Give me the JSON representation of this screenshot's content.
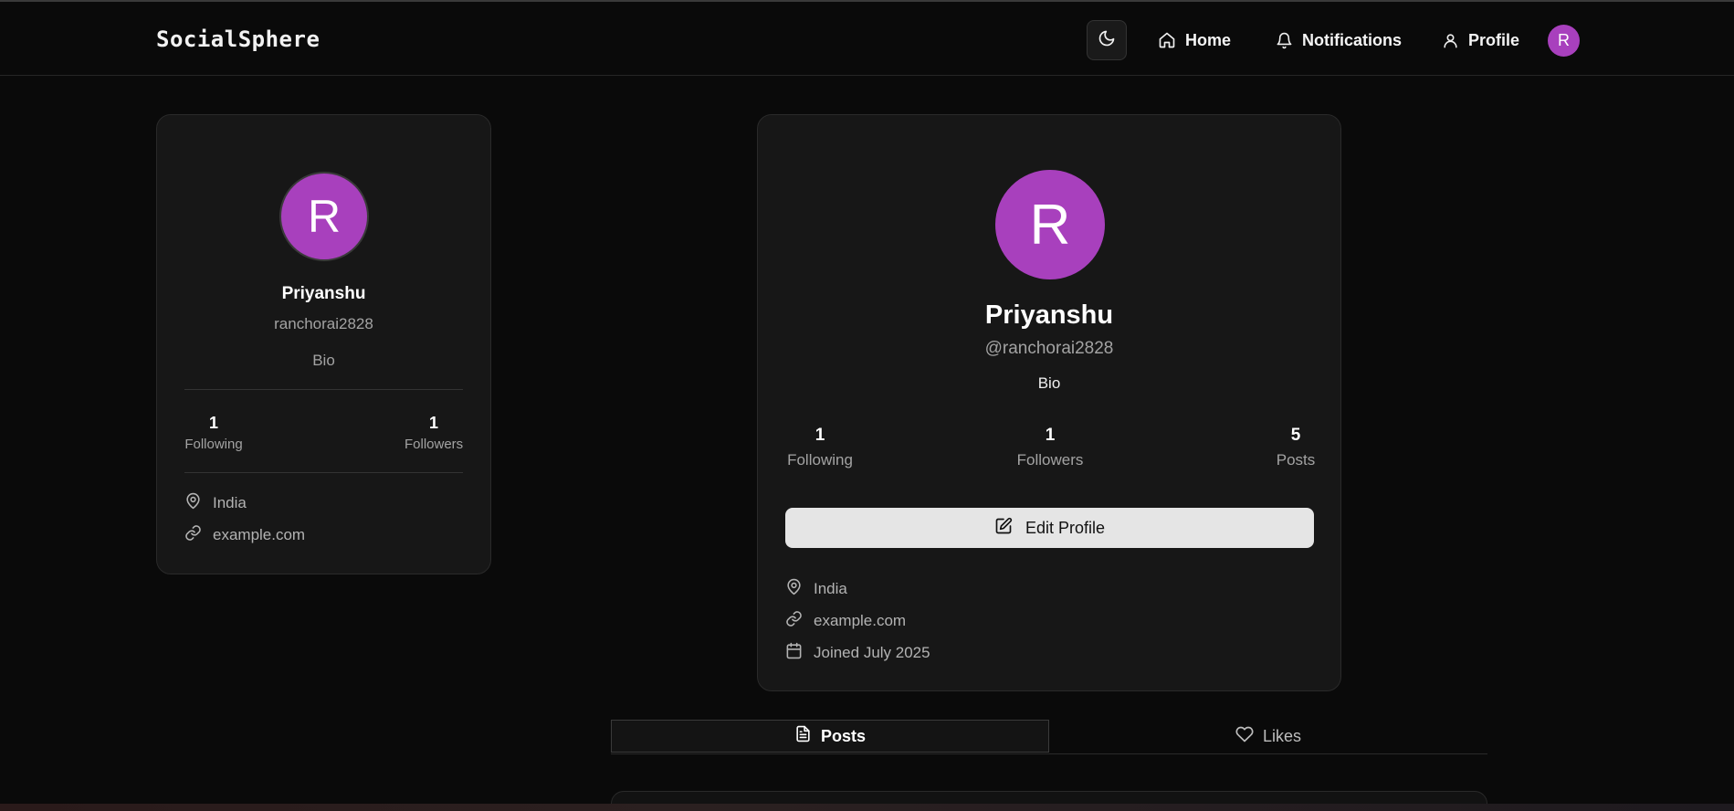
{
  "navbar": {
    "brand": "SocialSphere",
    "links": [
      {
        "label": "Home",
        "icon": "home-icon"
      },
      {
        "label": "Notifications",
        "icon": "bell-icon"
      },
      {
        "label": "Profile",
        "icon": "user-icon"
      }
    ],
    "avatar_initial": "R",
    "theme_icon": "moon-icon"
  },
  "sidebar_card": {
    "avatar_initial": "R",
    "name": "Priyanshu",
    "username": "ranchorai2828",
    "bio": "Bio",
    "stats": [
      {
        "value": "1",
        "label": "Following"
      },
      {
        "value": "1",
        "label": "Followers"
      }
    ],
    "location": "India",
    "website": "example.com"
  },
  "profile": {
    "avatar_initial": "R",
    "name": "Priyanshu",
    "handle": "@ranchorai2828",
    "bio": "Bio",
    "stats": [
      {
        "value": "1",
        "label": "Following"
      },
      {
        "value": "1",
        "label": "Followers"
      },
      {
        "value": "5",
        "label": "Posts"
      }
    ],
    "edit_button": "Edit Profile",
    "location": "India",
    "website": "example.com",
    "joined": "Joined July 2025"
  },
  "tabs": [
    {
      "label": "Posts",
      "icon": "file-text-icon",
      "active": true
    },
    {
      "label": "Likes",
      "icon": "heart-icon",
      "active": false
    }
  ],
  "colors": {
    "accent_avatar": "#a840bd",
    "background": "#0a0a0a",
    "card": "#171717"
  }
}
